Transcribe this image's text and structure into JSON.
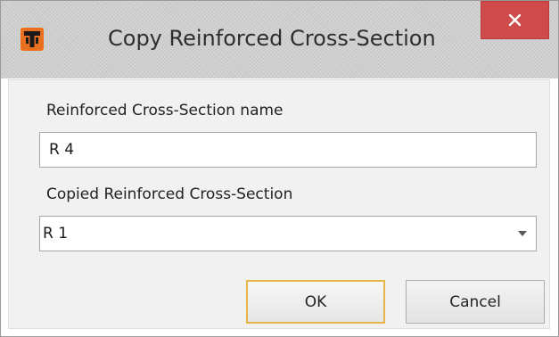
{
  "window": {
    "title": "Copy Reinforced Cross-Section",
    "app_icon": "app-logo-icon",
    "close_icon": "close-icon",
    "close_color": "#cf4a4a"
  },
  "form": {
    "name_label": "Reinforced Cross-Section name",
    "name_value": "R 4",
    "copied_label": "Copied Reinforced Cross-Section",
    "copied_value": "R 1",
    "dropdown_icon": "chevron-down-icon"
  },
  "buttons": {
    "ok_label": "OK",
    "cancel_label": "Cancel",
    "ok_focus_color": "#e7b64a"
  }
}
